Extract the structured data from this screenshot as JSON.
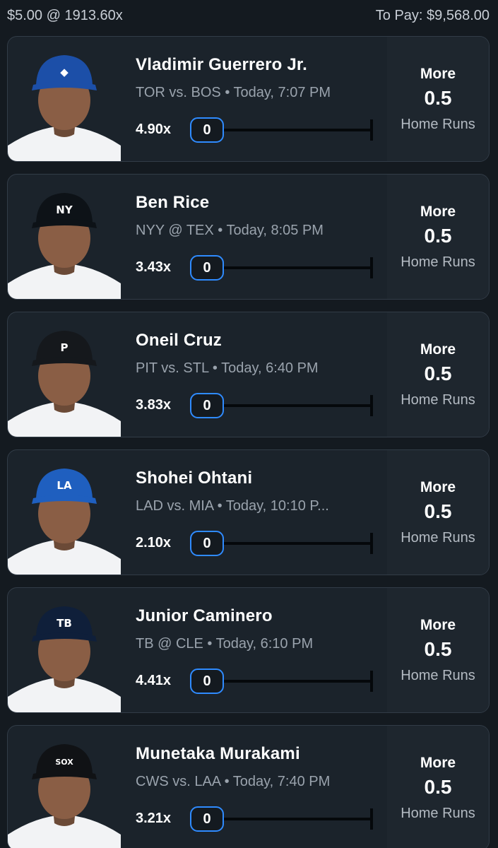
{
  "header": {
    "entry": "$5.00 @ 1913.60x",
    "to_pay": "To Pay: $9,568.00"
  },
  "picks": [
    {
      "name": "Vladimir Guerrero Jr.",
      "game": "TOR vs. BOS • Today, 7:07 PM",
      "multiplier": "4.90x",
      "count": "0",
      "direction": "More",
      "line": "0.5",
      "stat": "Home Runs",
      "cap_color": "#1c4fa8",
      "cap_logo": "blue-jays-logo"
    },
    {
      "name": "Ben Rice",
      "game": "NYY @ TEX • Today, 8:05 PM",
      "multiplier": "3.43x",
      "count": "0",
      "direction": "More",
      "line": "0.5",
      "stat": "Home Runs",
      "cap_color": "#0d1217",
      "cap_logo": "NY"
    },
    {
      "name": "Oneil Cruz",
      "game": "PIT vs. STL • Today, 6:40 PM",
      "multiplier": "3.83x",
      "count": "0",
      "direction": "More",
      "line": "0.5",
      "stat": "Home Runs",
      "cap_color": "#15181c",
      "cap_logo": "P"
    },
    {
      "name": "Shohei Ohtani",
      "game": "LAD vs. MIA • Today, 10:10 P...",
      "multiplier": "2.10x",
      "count": "0",
      "direction": "More",
      "line": "0.5",
      "stat": "Home Runs",
      "cap_color": "#1f5fbf",
      "cap_logo": "LA"
    },
    {
      "name": "Junior Caminero",
      "game": "TB @ CLE • Today, 6:10 PM",
      "multiplier": "4.41x",
      "count": "0",
      "direction": "More",
      "line": "0.5",
      "stat": "Home Runs",
      "cap_color": "#0f1f3a",
      "cap_logo": "TB"
    },
    {
      "name": "Munetaka Murakami",
      "game": "CWS vs. LAA • Today, 7:40 PM",
      "multiplier": "3.21x",
      "count": "0",
      "direction": "More",
      "line": "0.5",
      "stat": "Home Runs",
      "cap_color": "#101215",
      "cap_logo": "SOX"
    }
  ],
  "colors": {
    "background": "#141a20",
    "card": "#1b232b",
    "accent_blue": "#2f8bff"
  }
}
